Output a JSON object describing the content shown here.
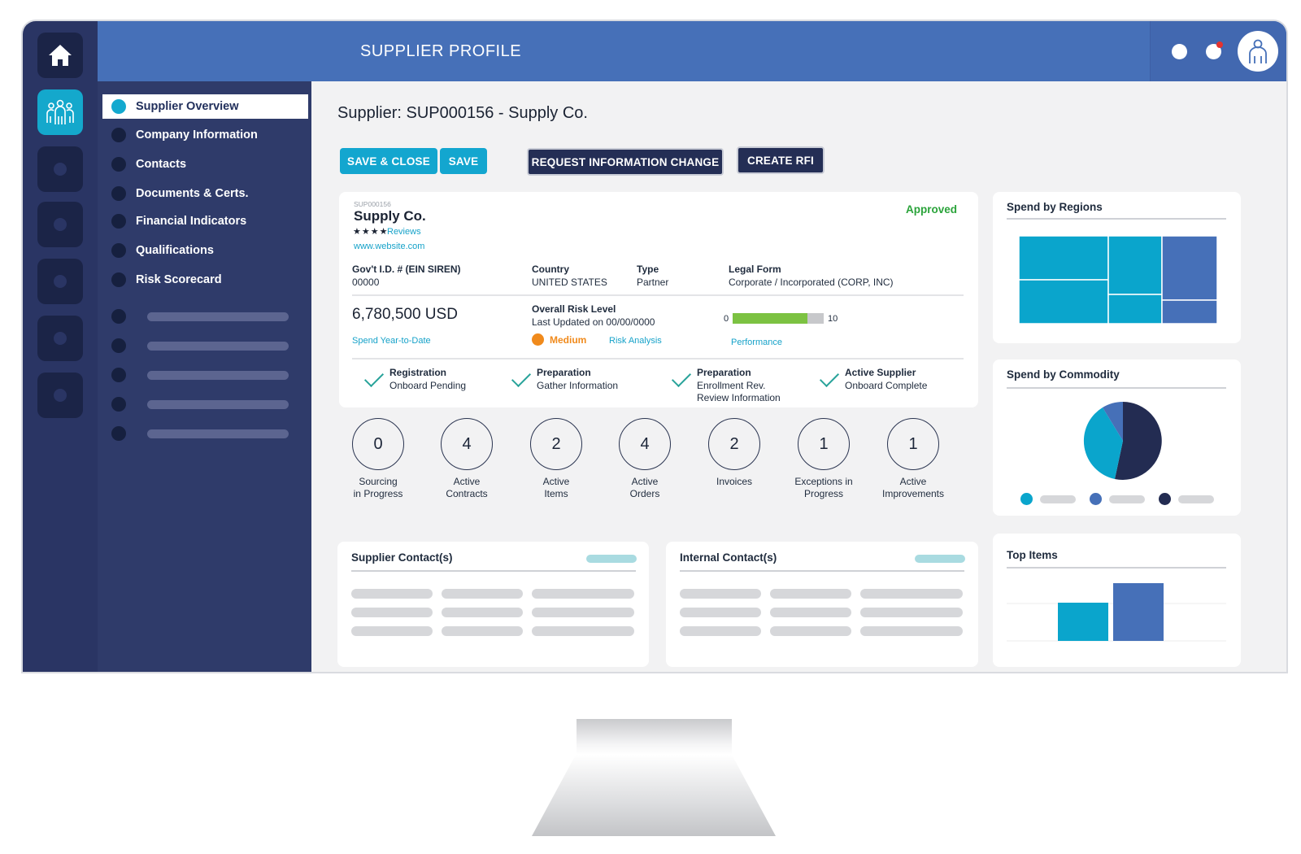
{
  "header": {
    "title": "SUPPLIER PROFILE"
  },
  "rail": {
    "icons": [
      "home-icon",
      "team-icon",
      "placeholder-icon",
      "placeholder-icon",
      "placeholder-icon",
      "placeholder-icon",
      "placeholder-icon"
    ]
  },
  "sidebar": {
    "items": [
      {
        "label": "Supplier Overview",
        "active": true
      },
      {
        "label": "Company Information"
      },
      {
        "label": "Contacts"
      },
      {
        "label": "Documents & Certs."
      },
      {
        "label": "Financial Indicators"
      },
      {
        "label": "Qualifications"
      },
      {
        "label": "Risk Scorecard"
      }
    ]
  },
  "page": {
    "title": "Supplier: SUP000156 - Supply Co."
  },
  "toolbar": {
    "save_close": "SAVE & CLOSE",
    "save": "SAVE",
    "request_change": "REQUEST INFORMATION CHANGE",
    "create_rfi": "CREATE RFI"
  },
  "supplier": {
    "id": "SUP000156",
    "name": "Supply Co.",
    "rating": "★★★★",
    "reviews": "Reviews",
    "website": "www.website.com",
    "status": "Approved",
    "fields": {
      "govt_label": "Gov't I.D. # (EIN SIREN)",
      "govt_value": "00000",
      "country_label": "Country",
      "country_value": "UNITED STATES",
      "type_label": "Type",
      "type_value": "Partner",
      "legal_label": "Legal Form",
      "legal_value": "Corporate / Incorporated (CORP, INC)"
    },
    "spend": {
      "value": "6,780,500 USD",
      "link": "Spend Year-to-Date"
    },
    "risk": {
      "label": "Overall Risk Level",
      "updated": "Last Updated on 00/00/0000",
      "level": "Medium",
      "link": "Risk Analysis"
    },
    "performance": {
      "min": "0",
      "max": "10",
      "value": 8.2,
      "link": "Performance"
    },
    "steps": [
      {
        "title": "Registration",
        "detail": "Onboard Pending"
      },
      {
        "title": "Preparation",
        "detail": "Gather Information"
      },
      {
        "title": "Preparation",
        "detail": "Enrollment Rev.",
        "detail2": "Review Information"
      },
      {
        "title": "Active Supplier",
        "detail": "Onboard Complete"
      }
    ]
  },
  "metrics": [
    {
      "value": "0",
      "line1": "Sourcing",
      "line2": "in Progress"
    },
    {
      "value": "4",
      "line1": "Active",
      "line2": "Contracts"
    },
    {
      "value": "2",
      "line1": "Active",
      "line2": "Items"
    },
    {
      "value": "4",
      "line1": "Active",
      "line2": "Orders"
    },
    {
      "value": "2",
      "line1": "Invoices",
      "line2": ""
    },
    {
      "value": "1",
      "line1": "Exceptions in",
      "line2": "Progress"
    },
    {
      "value": "1",
      "line1": "Active",
      "line2": "Improvements"
    }
  ],
  "contacts": {
    "supplier_title": "Supplier Contact(s)",
    "internal_title": "Internal Contact(s)"
  },
  "widgets": {
    "regions_title": "Spend by Regions",
    "commodity_title": "Spend by Commodity",
    "top_items_title": "Top Items"
  },
  "colors": {
    "teal": "#13a6cf",
    "blue": "#4670b8",
    "navy": "#242e55",
    "approved": "#2aa33a",
    "medium": "#f08a1c",
    "bar": "#7cc242"
  }
}
